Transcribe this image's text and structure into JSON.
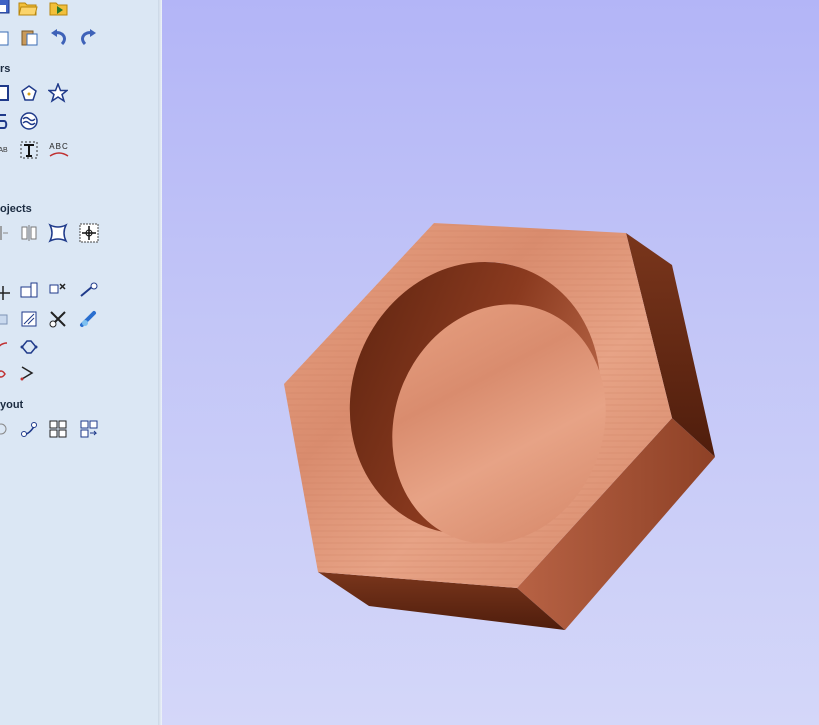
{
  "sidebar": {
    "sections": {
      "vectors": "rs",
      "objects": "ojects",
      "layout": "yout"
    },
    "engraving_text": "ABC",
    "small_text": "AB"
  },
  "viewport": {
    "background_top": "#b3b5f7",
    "background_bottom": "#d4d7f9",
    "object_wood_light": "#e39c7e",
    "object_wood_dark": "#6a2c16"
  },
  "icons": [
    "save-icon",
    "open-folder-icon",
    "open-recent-icon",
    "copy-icon",
    "paste-icon",
    "undo-icon",
    "redo-icon",
    "rectangle-icon",
    "polygon-icon",
    "star-icon",
    "spiral-icon",
    "wave-icon",
    "text-icon",
    "text-on-curve-icon",
    "mirror-icon",
    "distort-icon",
    "center-object-icon",
    "move-icon",
    "align-icon",
    "delete-icon",
    "node-edit-icon",
    "join-icon",
    "smooth-icon",
    "fillet-icon",
    "nest-icon",
    "array-icon",
    "step-repeat-icon"
  ]
}
